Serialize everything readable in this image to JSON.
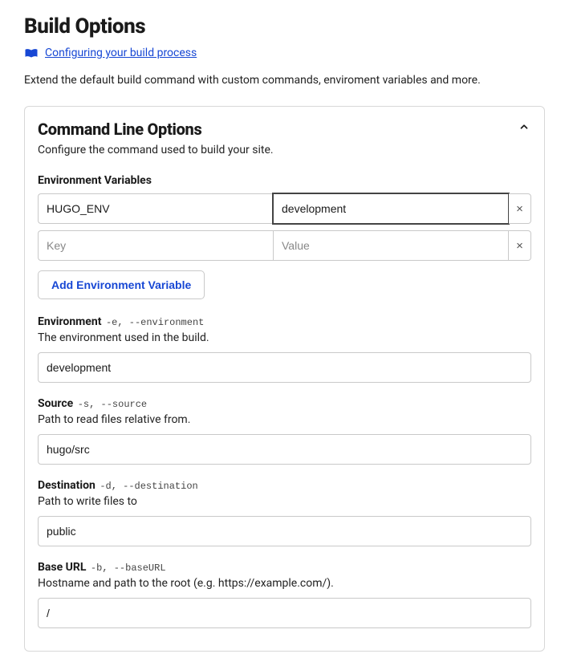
{
  "page": {
    "title": "Build Options",
    "helpLink": "Configuring your build process",
    "description": "Extend the default build command with custom commands, enviroment variables and more."
  },
  "card": {
    "title": "Command Line Options",
    "subtitle": "Configure the command used to build your site.",
    "env": {
      "label": "Environment Variables",
      "rows": [
        {
          "key": "HUGO_ENV",
          "value": "development",
          "focused": true
        },
        {
          "key": "",
          "value": ""
        }
      ],
      "keyPlaceholder": "Key",
      "valuePlaceholder": "Value",
      "removeGlyph": "×",
      "addLabel": "Add Environment Variable"
    },
    "fields": [
      {
        "label": "Environment",
        "flag": "-e, --environment",
        "help": "The environment used in the build.",
        "value": "development"
      },
      {
        "label": "Source",
        "flag": "-s, --source",
        "help": "Path to read files relative from.",
        "value": "hugo/src"
      },
      {
        "label": "Destination",
        "flag": "-d, --destination",
        "help": "Path to write files to",
        "value": "public"
      },
      {
        "label": "Base URL",
        "flag": "-b, --baseURL",
        "help": "Hostname and path to the root (e.g. https://example.com/).",
        "value": "/"
      }
    ]
  }
}
